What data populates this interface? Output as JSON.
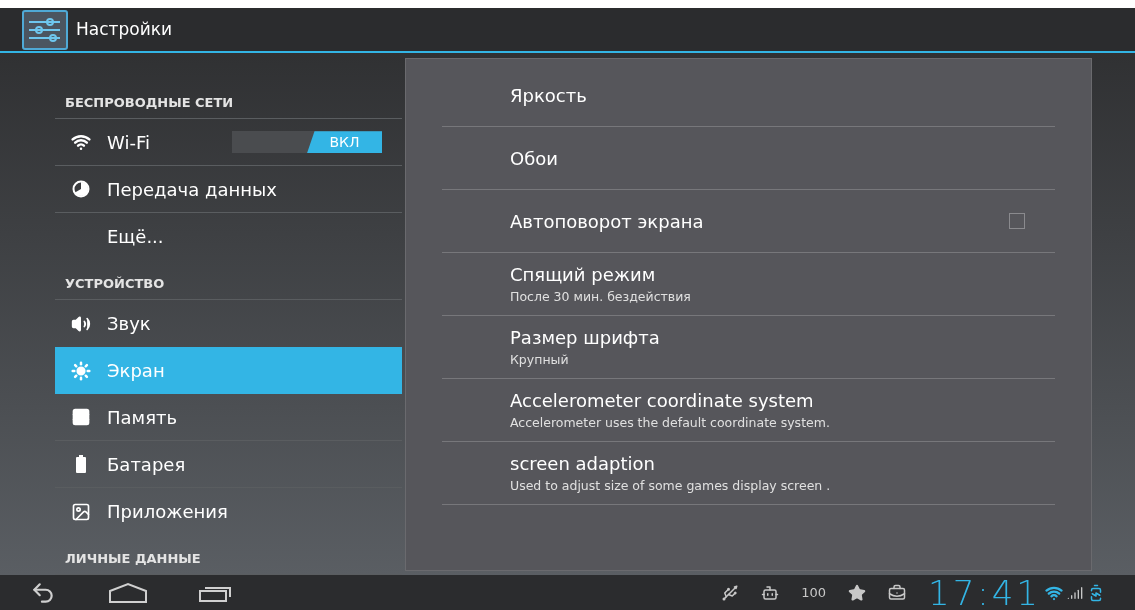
{
  "action_bar": {
    "title": "Настройки"
  },
  "sidebar": {
    "items": [
      {
        "kind": "header",
        "label": "БЕСПРОВОДНЫЕ СЕТИ"
      },
      {
        "kind": "item",
        "label": "Wi-Fi",
        "selected": false,
        "toggle": {
          "on": true,
          "label": "ВКЛ"
        }
      },
      {
        "kind": "item",
        "label": "Передача данных",
        "selected": false
      },
      {
        "kind": "item",
        "label": "Ещё...",
        "selected": false
      },
      {
        "kind": "header",
        "label": "УСТРОЙСТВО"
      },
      {
        "kind": "item",
        "label": "Звук",
        "selected": false
      },
      {
        "kind": "item",
        "label": "Экран",
        "selected": true
      },
      {
        "kind": "item",
        "label": "Память",
        "selected": false
      },
      {
        "kind": "item",
        "label": "Батарея",
        "selected": false
      },
      {
        "kind": "item",
        "label": "Приложения",
        "selected": false
      },
      {
        "kind": "header",
        "label": "ЛИЧНЫЕ ДАННЫЕ"
      }
    ]
  },
  "settings": [
    {
      "title": "Яркость"
    },
    {
      "title": "Обои"
    },
    {
      "title": "Автоповорот экрана",
      "checked": false
    },
    {
      "title": "Спящий режим",
      "summary": "После 30 мин. бездействия"
    },
    {
      "title": "Размер шрифта",
      "summary": "Крупный"
    },
    {
      "title": "Accelerometer coordinate system",
      "summary": "Accelerometer uses the default coordinate system."
    },
    {
      "title": "screen adaption",
      "summary": "Used to adjust size of some games display screen ."
    }
  ],
  "status_bar": {
    "battery_percent": "100",
    "time": "17:41"
  }
}
